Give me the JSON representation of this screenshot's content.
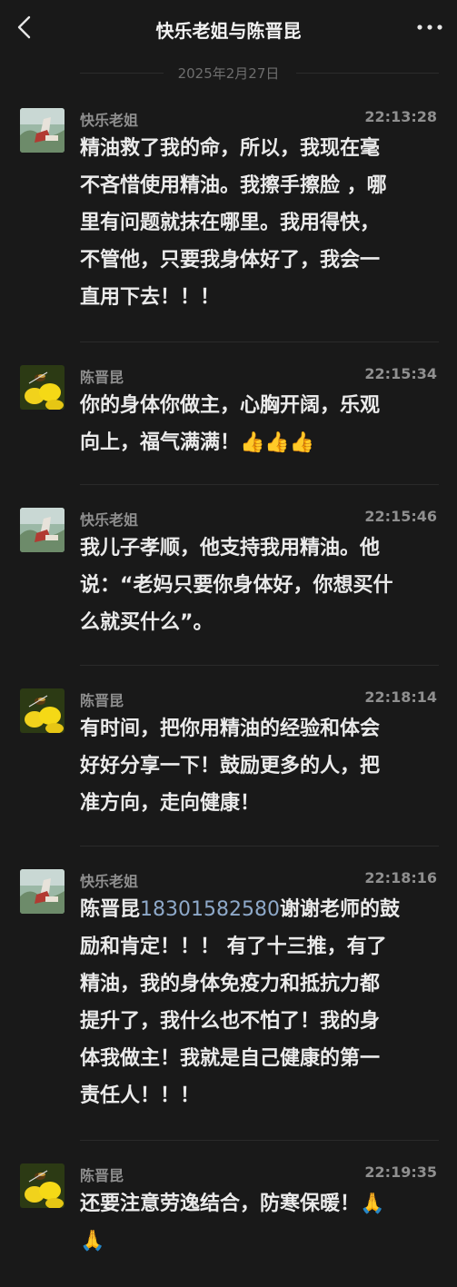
{
  "header": {
    "title": "快乐老姐与陈晋昆"
  },
  "date_divider": "2025年2月27日",
  "messages": [
    {
      "sender": "快乐老姐",
      "time": "22:13:28",
      "avatar": "landscape-avatar",
      "lines": [
        "精油救了我的命，所以，我现在毫",
        "不吝惜使用精油。我擦手擦脸 ，哪",
        "里有问题就抹在哪里。我用得快，",
        "不管他，只要我身体好了，我会一",
        "直用下去！！！"
      ]
    },
    {
      "sender": "陈晋昆",
      "time": "22:15:34",
      "avatar": "flower-bee-avatar",
      "lines": [
        "你的身体你做主，心胸开阔，乐观",
        "向上，福气满满！👍👍👍"
      ]
    },
    {
      "sender": "快乐老姐",
      "time": "22:15:46",
      "avatar": "landscape-avatar",
      "lines": [
        "我儿子孝顺，他支持我用精油。他",
        "说：“老妈只要你身体好，你想买什",
        "么就买什么”。"
      ]
    },
    {
      "sender": "陈晋昆",
      "time": "22:18:14",
      "avatar": "flower-bee-avatar",
      "lines": [
        "有时间，把你用精油的经验和体会",
        "好好分享一下！鼓励更多的人，把",
        "准方向，走向健康！"
      ]
    },
    {
      "sender": "快乐老姐",
      "time": "22:18:16",
      "avatar": "landscape-avatar",
      "first_line_prefix": "陈晋昆",
      "phone_link": "18301582580",
      "first_line_suffix": "谢谢老师的鼓",
      "lines": [
        "励和肯定！！！ 有了十三推，有了",
        "精油，我的身体免疫力和抵抗力都",
        "提升了，我什么也不怕了！我的身",
        "体我做主！我就是自己健康的第一",
        "责任人！！！"
      ]
    },
    {
      "sender": "陈晋昆",
      "time": "22:19:35",
      "avatar": "flower-bee-avatar",
      "lines": [
        "还要注意劳逸结合，防寒保暖！🙏",
        "🙏"
      ]
    }
  ]
}
